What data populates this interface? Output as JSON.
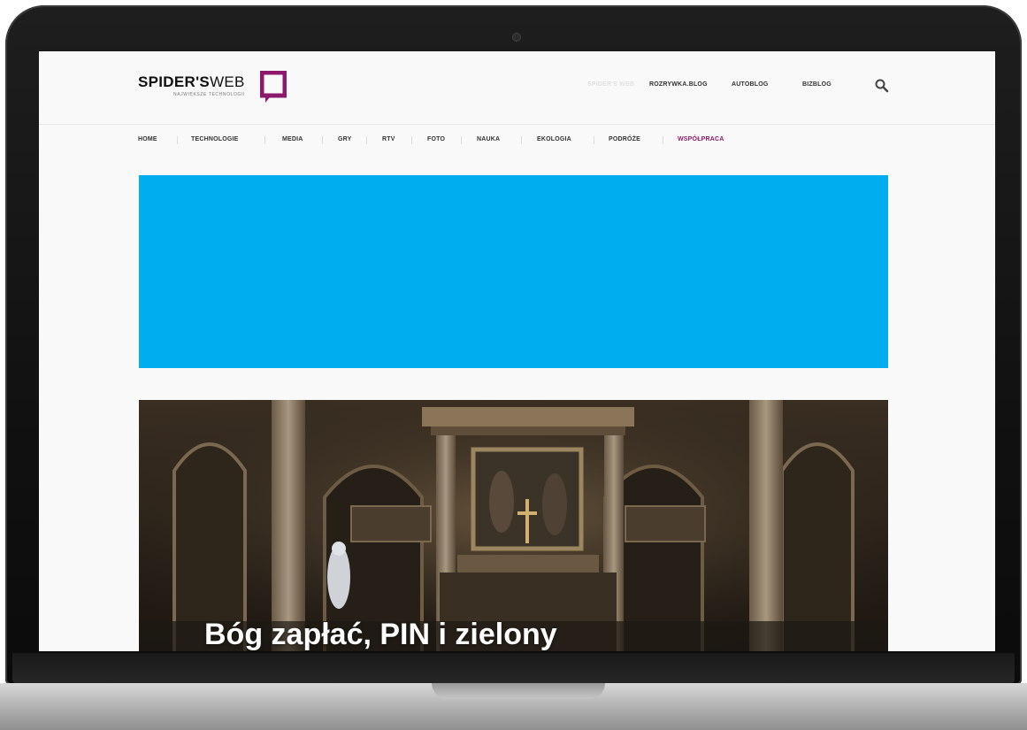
{
  "site": {
    "logo": {
      "name_bold": "SPIDER'S",
      "name_light": "WEB",
      "tagline": "NAJWIĘKSZE TECHNOLOGII"
    },
    "top_links": [
      {
        "label": "SPIDER'S WEB",
        "faded": true
      },
      {
        "label": "ROZRYWKA.BLOG",
        "faded": false
      },
      {
        "label": "AUTOBLOG",
        "faded": false
      },
      {
        "label": "BIZBLOG",
        "faded": false
      }
    ],
    "search_icon": "search-icon",
    "nav": [
      {
        "label": "HOME",
        "accent": false
      },
      {
        "label": "TECHNOLOGIE",
        "accent": false
      },
      {
        "label": "MEDIA",
        "accent": false
      },
      {
        "label": "GRY",
        "accent": false
      },
      {
        "label": "RTV",
        "accent": false
      },
      {
        "label": "FOTO",
        "accent": false
      },
      {
        "label": "NAUKA",
        "accent": false
      },
      {
        "label": "EKOLOGIA",
        "accent": false
      },
      {
        "label": "PODRÓŻE",
        "accent": false
      },
      {
        "label": "WSPÓŁPRACA",
        "accent": true
      }
    ]
  },
  "ad": {
    "color": "#00adef"
  },
  "hero": {
    "title": "Bóg zapłać, PIN i zielony"
  },
  "colors": {
    "accent": "#8b1a6b",
    "brand_icon": "#8b1a6b",
    "ad_blue": "#00adef"
  }
}
